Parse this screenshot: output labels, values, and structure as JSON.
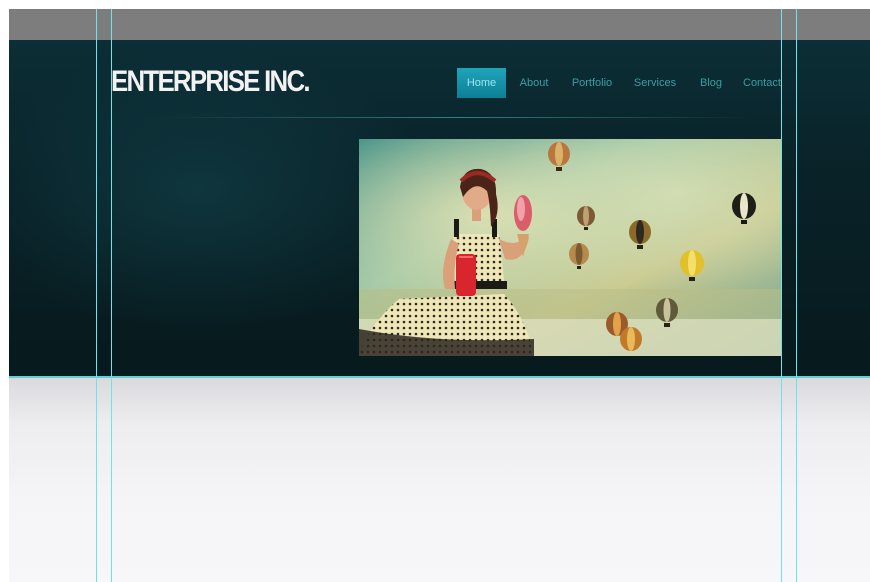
{
  "header": {
    "logo_text": "ENTERPRISE INC."
  },
  "nav": {
    "items": [
      {
        "label": "Home",
        "active": true
      },
      {
        "label": "About",
        "active": false
      },
      {
        "label": "Portfolio",
        "active": false
      },
      {
        "label": "Services",
        "active": false
      },
      {
        "label": "Blog",
        "active": false
      },
      {
        "label": "Contact",
        "active": false
      }
    ]
  },
  "hero": {
    "image_icon": "hero-photo-icon"
  },
  "colors": {
    "hero_background": "#092228",
    "nav_active": "#1ea4ba",
    "nav_text": "#3a9fa6",
    "guide_line": "#6fe3eb",
    "canvas_top_bar": "#7d7d7d"
  }
}
